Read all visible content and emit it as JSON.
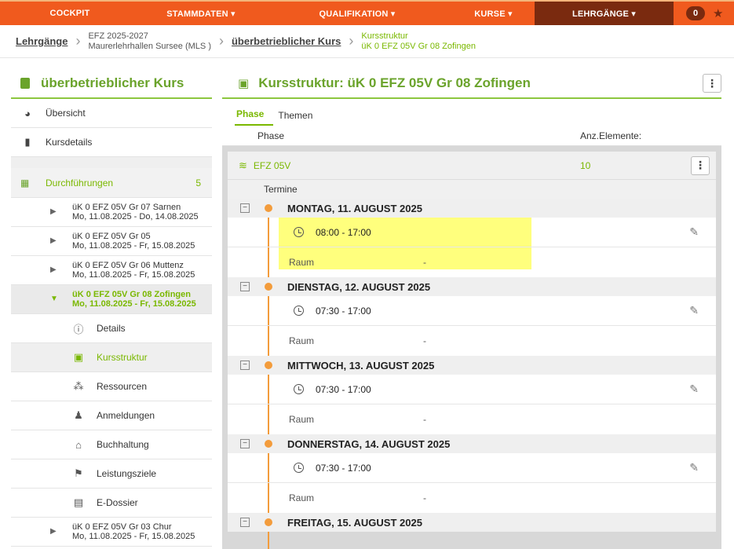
{
  "topnav": {
    "items": [
      {
        "label": "COCKPIT"
      },
      {
        "label": "STAMMDATEN ▾"
      },
      {
        "label": "QUALIFIKATION ▾"
      },
      {
        "label": "KURSE ▾"
      },
      {
        "label": "LEHRGÄNGE ▾"
      }
    ],
    "badge": "0",
    "star_icon": "star-icon"
  },
  "breadcrumb": {
    "root": "Lehrgänge",
    "level2_line1": "EFZ 2025-2027",
    "level2_line2": "Maurerlehrhallen Sursee (MLS )",
    "level3": "überbetrieblicher Kurs",
    "level4_line1": "Kursstruktur",
    "level4_line2": "üK 0 EFZ 05V Gr 08 Zofingen"
  },
  "sidebar": {
    "title": "überbetrieblicher Kurs",
    "nav": [
      {
        "label": "Übersicht",
        "icon": "palette-icon"
      },
      {
        "label": "Kursdetails",
        "icon": "book-icon"
      }
    ],
    "durchfuehrungen": {
      "label": "Durchführungen",
      "count": "5"
    },
    "runs": [
      {
        "line1": "üK 0 EFZ 05V Gr 07 Sarnen",
        "line2": "Mo, 11.08.2025 - Do, 14.08.2025"
      },
      {
        "line1": "üK 0 EFZ 05V Gr 05",
        "line2": "Mo, 11.08.2025 - Fr, 15.08.2025"
      },
      {
        "line1": "üK 0 EFZ 05V Gr 06 Muttenz",
        "line2": "Mo, 11.08.2025 - Fr, 15.08.2025"
      },
      {
        "line1": "üK 0 EFZ 05V Gr 08 Zofingen",
        "line2": "Mo, 11.08.2025 - Fr, 15.08.2025"
      }
    ],
    "subnav": [
      {
        "label": "Details",
        "icon": "info-icon"
      },
      {
        "label": "Kursstruktur",
        "icon": "structure-icon"
      },
      {
        "label": "Ressourcen",
        "icon": "resources-icon"
      },
      {
        "label": "Anmeldungen",
        "icon": "user-icon"
      },
      {
        "label": "Buchhaltung",
        "icon": "accounting-icon"
      },
      {
        "label": "Leistungsziele",
        "icon": "flag-icon"
      },
      {
        "label": "E-Dossier",
        "icon": "dossier-icon"
      }
    ],
    "run_last": {
      "line1": "üK 0 EFZ 05V Gr 03 Chur",
      "line2": "Mo, 11.08.2025 - Fr, 15.08.2025"
    }
  },
  "main": {
    "title": "Kursstruktur: üK 0 EFZ 05V Gr 08 Zofingen",
    "tabs": [
      {
        "label": "Phase"
      },
      {
        "label": "Themen"
      }
    ],
    "col_phase": "Phase",
    "col_count": "Anz.Elemente:",
    "phase_name": "EFZ 05V",
    "phase_count": "10",
    "termine_label": "Termine",
    "raum_label": "Raum",
    "raum_value": "-",
    "days": [
      {
        "label": "MONTAG, 11. AUGUST 2025",
        "time": "08:00 - 17:00"
      },
      {
        "label": "DIENSTAG, 12. AUGUST 2025",
        "time": "07:30 - 17:00"
      },
      {
        "label": "MITTWOCH, 13. AUGUST 2025",
        "time": "07:30 - 17:00"
      },
      {
        "label": "DONNERSTAG, 14. AUGUST 2025",
        "time": "07:30 - 17:00"
      },
      {
        "label": "FREITAG, 15. AUGUST 2025",
        "time": ""
      }
    ]
  }
}
